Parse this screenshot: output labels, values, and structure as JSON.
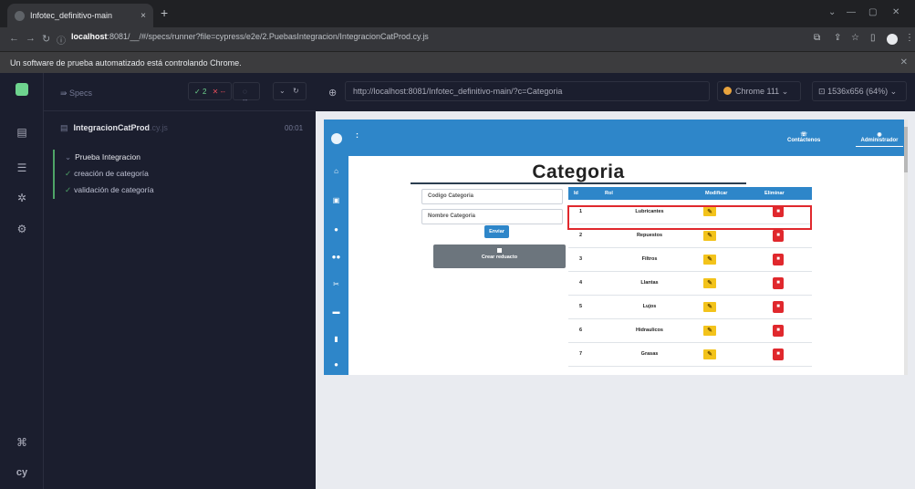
{
  "browser": {
    "tab_title": "Infotec_definitivo-main",
    "tab_close": "×",
    "new_tab": "+",
    "url_host": "localhost",
    "url_rest": ":8081/__/#/specs/runner?file=cypress/e2e/2.PuebasIntegracion/IntegracionCatProd.cy.js",
    "automation_notice": "Un software de prueba automatizado está controlando Chrome."
  },
  "runner": {
    "specs_label": "Specs",
    "passed": "2",
    "failed": "--",
    "pending": "--",
    "spec_file": "IntegracionCatProd",
    "spec_ext": ".cy.js",
    "duration": "00:01",
    "suite_title": "Prueba Integracion",
    "tests": [
      "creación de categoría",
      "validación de categoría"
    ],
    "aut_url": "http://localhost:8081/Infotec_definitivo-main/?c=Categoria",
    "browser_name": "Chrome 111",
    "viewport": "1536x656 (64%)"
  },
  "app": {
    "nav": {
      "dots": ":",
      "contact_label": "Contáctenos",
      "admin_label": "Administrador"
    },
    "title": "Categoria",
    "form": {
      "code_placeholder": "Codigo Categoria",
      "name_placeholder": "Nombre Categoria",
      "submit_label": "Enviar",
      "report_label": "Crear reduacto"
    },
    "table": {
      "headers": [
        "Id",
        "Rol",
        "Modificar",
        "Eliminar"
      ],
      "rows": [
        {
          "id": "1",
          "name": "Lubricantes"
        },
        {
          "id": "2",
          "name": "Repuestos"
        },
        {
          "id": "3",
          "name": "Filtros"
        },
        {
          "id": "4",
          "name": "Llantas"
        },
        {
          "id": "5",
          "name": "Lujos"
        },
        {
          "id": "6",
          "name": "Hidraulicos"
        },
        {
          "id": "7",
          "name": "Grasas"
        }
      ]
    }
  },
  "colors": {
    "app_blue": "#2e86c9",
    "edit_yellow": "#f3c31b",
    "delete_red": "#e0282d",
    "cypress_pass": "#4ea467"
  }
}
